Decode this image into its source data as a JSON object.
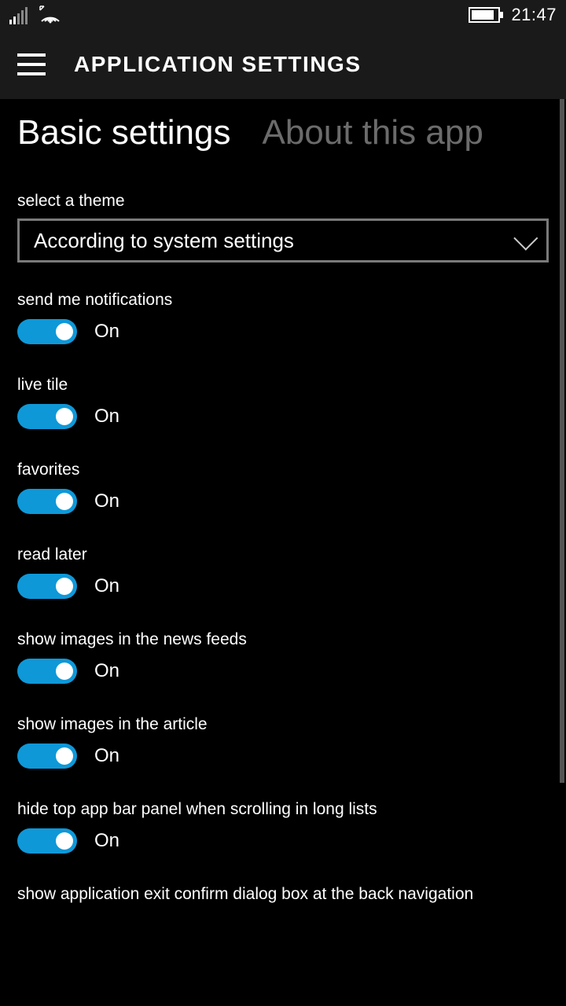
{
  "statusbar": {
    "time": "21:47"
  },
  "appbar": {
    "title": "APPLICATION SETTINGS"
  },
  "tabs": {
    "basic": "Basic settings",
    "about": "About this app"
  },
  "theme": {
    "label": "select a theme",
    "value": "According to system settings"
  },
  "toggles": [
    {
      "label": "send me notifications",
      "state": "On"
    },
    {
      "label": "live tile",
      "state": "On"
    },
    {
      "label": "favorites",
      "state": "On"
    },
    {
      "label": "read later",
      "state": "On"
    },
    {
      "label": "show images in the news feeds",
      "state": "On"
    },
    {
      "label": "show images in the article",
      "state": "On"
    },
    {
      "label": "hide top app bar panel when scrolling in long lists",
      "state": "On"
    }
  ],
  "partial_next_label": "show application exit confirm dialog box at the back navigation"
}
